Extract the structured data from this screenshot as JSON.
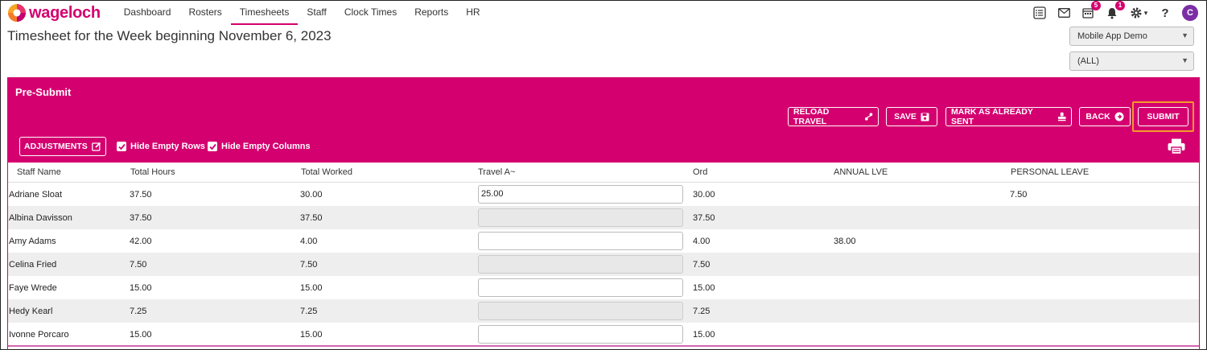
{
  "app": {
    "brand": "wageloch"
  },
  "nav": {
    "items": [
      "Dashboard",
      "Rosters",
      "Timesheets",
      "Staff",
      "Clock Times",
      "Reports",
      "HR"
    ],
    "active_index": 2,
    "icons": [
      "task-list-icon",
      "mail-icon",
      "calendar-icon",
      "bell-icon",
      "gear-icon",
      "help-icon"
    ],
    "calendar_badge": "5",
    "bell_badge": "1",
    "help_label": "?",
    "avatar_initial": "C"
  },
  "page": {
    "title": "Timesheet for the Week beginning November 6, 2023"
  },
  "selects": {
    "company": "Mobile App Demo",
    "filter": "(ALL)"
  },
  "panel": {
    "title": "Pre-Submit",
    "buttons": {
      "reload_travel": "RELOAD TRAVEL",
      "save": "SAVE",
      "mark_sent": "MARK AS ALREADY SENT",
      "back": "BACK",
      "submit": "SUBMIT",
      "adjustments": "ADJUSTMENTS"
    },
    "hide_empty_rows": "Hide Empty Rows",
    "hide_empty_columns": "Hide Empty Columns"
  },
  "table": {
    "columns": [
      "Staff Name",
      "Total Hours",
      "Total Worked",
      "Travel A~",
      "Ord",
      "ANNUAL LVE",
      "PERSONAL LEAVE"
    ],
    "rows": [
      {
        "name": "Adriane Sloat",
        "total_hours": "37.50",
        "total_worked": "30.00",
        "travel": "25.00",
        "travel_editable": true,
        "ord": "30.00",
        "annual": "",
        "personal": "7.50"
      },
      {
        "name": "Albina Davisson",
        "total_hours": "37.50",
        "total_worked": "37.50",
        "travel": "",
        "travel_editable": false,
        "ord": "37.50",
        "annual": "",
        "personal": ""
      },
      {
        "name": "Amy Adams",
        "total_hours": "42.00",
        "total_worked": "4.00",
        "travel": "",
        "travel_editable": true,
        "ord": "4.00",
        "annual": "38.00",
        "personal": ""
      },
      {
        "name": "Celina Fried",
        "total_hours": "7.50",
        "total_worked": "7.50",
        "travel": "",
        "travel_editable": false,
        "ord": "7.50",
        "annual": "",
        "personal": ""
      },
      {
        "name": "Faye Wrede",
        "total_hours": "15.00",
        "total_worked": "15.00",
        "travel": "",
        "travel_editable": true,
        "ord": "15.00",
        "annual": "",
        "personal": ""
      },
      {
        "name": "Hedy Kearl",
        "total_hours": "7.25",
        "total_worked": "7.25",
        "travel": "",
        "travel_editable": false,
        "ord": "7.25",
        "annual": "",
        "personal": ""
      },
      {
        "name": "Ivonne Porcaro",
        "total_hours": "15.00",
        "total_worked": "15.00",
        "travel": "",
        "travel_editable": true,
        "ord": "15.00",
        "annual": "",
        "personal": ""
      }
    ]
  },
  "colors": {
    "brand": "#d4006f",
    "highlight": "#f39a2b",
    "avatar": "#7b2ea6"
  }
}
